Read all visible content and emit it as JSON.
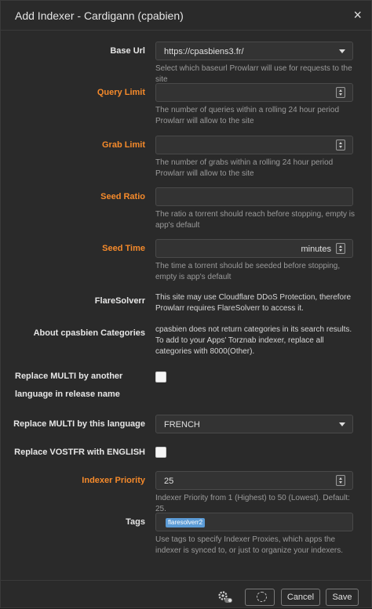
{
  "header": {
    "title": "Add Indexer - Cardigann (cpabien)",
    "close_glyph": "×"
  },
  "fields": {
    "base_url": {
      "label": "Base Url",
      "value": "https://cpasbiens3.fr/",
      "help": "Select which baseurl Prowlarr will use for requests to the site"
    },
    "query_limit": {
      "label": "Query Limit",
      "value": "",
      "help": "The number of queries within a rolling 24 hour period Prowlarr will allow to the site"
    },
    "grab_limit": {
      "label": "Grab Limit",
      "value": "",
      "help": "The number of grabs within a rolling 24 hour period Prowlarr will allow to the site"
    },
    "seed_ratio": {
      "label": "Seed Ratio",
      "value": "",
      "help": "The ratio a torrent should reach before stopping, empty is app's default"
    },
    "seed_time": {
      "label": "Seed Time",
      "value": "",
      "unit": "minutes",
      "help": "The time a torrent should be seeded before stopping, empty is app's default"
    },
    "flaresolverr": {
      "label": "FlareSolverr",
      "text": "This site may use Cloudflare DDoS Protection, therefore Prowlarr requires FlareSolverr to access it."
    },
    "about_categories": {
      "label": "About cpasbien Categories",
      "text": "cpasbien does not return categories in its search results. To add to your Apps' Torznab indexer, replace all categories with 8000(Other)."
    },
    "replace_multi_other": {
      "label": "Replace MULTI by another language in release name",
      "checked": false
    },
    "replace_multi_lang": {
      "label": "Replace MULTI by this language",
      "value": "FRENCH"
    },
    "replace_vostfr": {
      "label": "Replace VOSTFR with ENGLISH",
      "checked": false
    },
    "indexer_priority": {
      "label": "Indexer Priority",
      "value": "25",
      "help": "Indexer Priority from 1 (Highest) to 50 (Lowest). Default: 25."
    },
    "tags": {
      "label": "Tags",
      "tag": "flaresolverr2",
      "help": "Use tags to specify Indexer Proxies, which apps the indexer is synced to, or just to organize your indexers."
    }
  },
  "footer": {
    "cancel_label": "Cancel",
    "save_label": "Save"
  },
  "icons": {
    "gear": "gear-toggle-icon",
    "test": "spinner-icon",
    "caret": "chevron-down-icon"
  },
  "colors": {
    "advanced_label": "#f58a2b",
    "tag_bg": "#5b9bd6",
    "background": "#2a2a2a"
  }
}
